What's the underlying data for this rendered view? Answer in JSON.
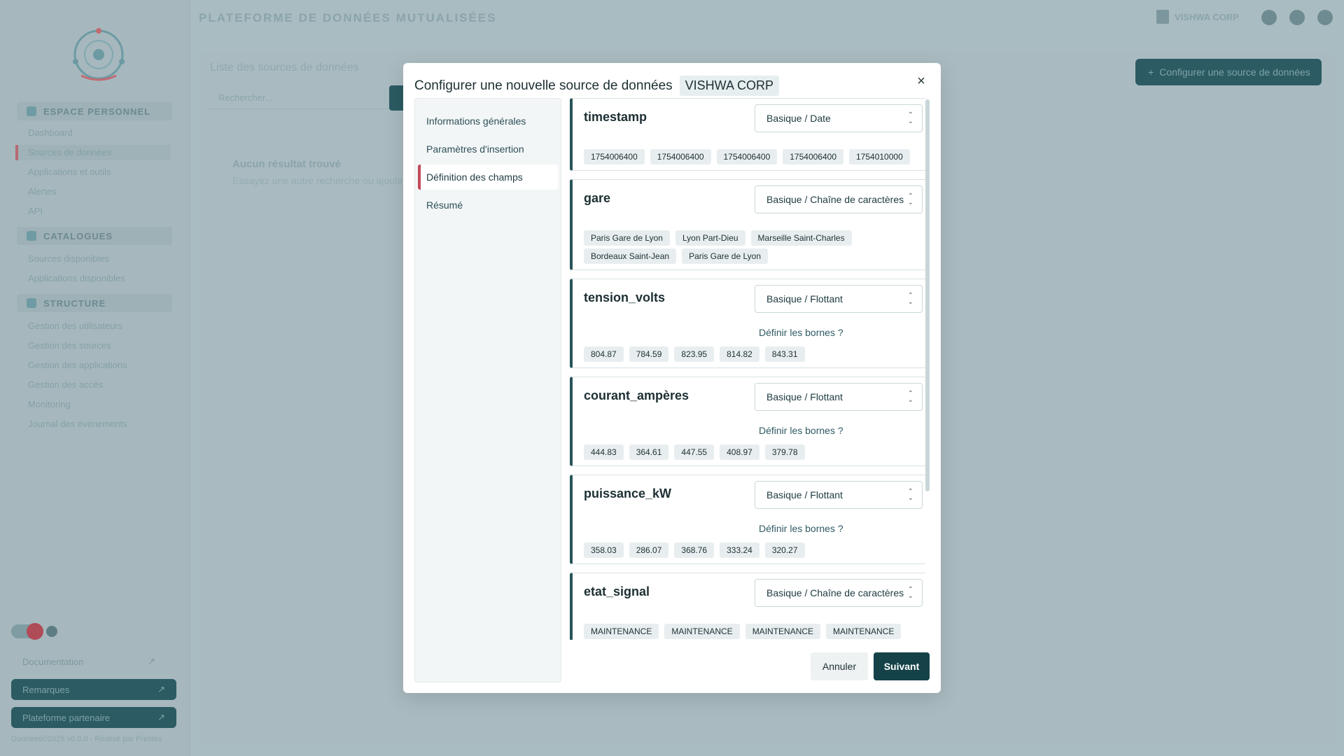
{
  "app": {
    "title": "PLATEFORME DE DONNÉES MUTUALISÉES",
    "org": "VISHWA CORP"
  },
  "sidebar": {
    "sections": [
      {
        "label": "ESPACE PERSONNEL",
        "items": [
          "Dashboard",
          "Sources de données",
          "Applications et outils",
          "Alertes",
          "API"
        ]
      },
      {
        "label": "CATALOGUES",
        "items": [
          "Sources disponibles",
          "Applications disponibles"
        ]
      },
      {
        "label": "STRUCTURE",
        "items": [
          "Gestion des utilisateurs",
          "Gestion des sources",
          "Gestion des applications",
          "Gestion des accès",
          "Monitoring",
          "Journal des événements"
        ]
      }
    ],
    "documentation": "Documentation",
    "buttons": [
      "Remarques",
      "Plateforme partenaire"
    ],
    "copyright": "Données©2025 v0.0.0 - Réalisé par Prestex"
  },
  "main": {
    "list_title": "Liste des sources de données",
    "search_placeholder": "Rechercher...",
    "config_button": "Configurer une source de données",
    "empty_title": "Aucun résultat trouvé",
    "empty_subtitle": "Essayez une autre recherche ou ajoutez une source"
  },
  "modal": {
    "title": "Configurer une nouvelle source de données",
    "org_badge": "VISHWA CORP",
    "close": "×",
    "steps": [
      "Informations générales",
      "Paramètres d'insertion",
      "Définition des champs",
      "Résumé"
    ],
    "active_step": 2,
    "bornes_label": "Définir les bornes ?",
    "fields": [
      {
        "name": "timestamp",
        "type": "Basique / Date",
        "bounds": false,
        "samples": [
          "1754006400",
          "1754006400",
          "1754006400",
          "1754006400",
          "1754010000"
        ]
      },
      {
        "name": "gare",
        "type": "Basique / Chaîne de caractères",
        "bounds": false,
        "samples": [
          "Paris Gare de Lyon",
          "Lyon Part-Dieu",
          "Marseille Saint-Charles",
          "Bordeaux Saint-Jean",
          "Paris Gare de Lyon"
        ]
      },
      {
        "name": "tension_volts",
        "type": "Basique / Flottant",
        "bounds": true,
        "samples": [
          "804.87",
          "784.59",
          "823.95",
          "814.82",
          "843.31"
        ]
      },
      {
        "name": "courant_ampères",
        "type": "Basique / Flottant",
        "bounds": true,
        "samples": [
          "444.83",
          "364.61",
          "447.55",
          "408.97",
          "379.78"
        ]
      },
      {
        "name": "puissance_kW",
        "type": "Basique / Flottant",
        "bounds": true,
        "samples": [
          "358.03",
          "286.07",
          "368.76",
          "333.24",
          "320.27"
        ]
      },
      {
        "name": "etat_signal",
        "type": "Basique / Chaîne de caractères",
        "bounds": false,
        "samples": [
          "MAINTENANCE",
          "MAINTENANCE",
          "MAINTENANCE",
          "MAINTENANCE"
        ]
      }
    ],
    "cancel_label": "Annuler",
    "next_label": "Suivant"
  }
}
